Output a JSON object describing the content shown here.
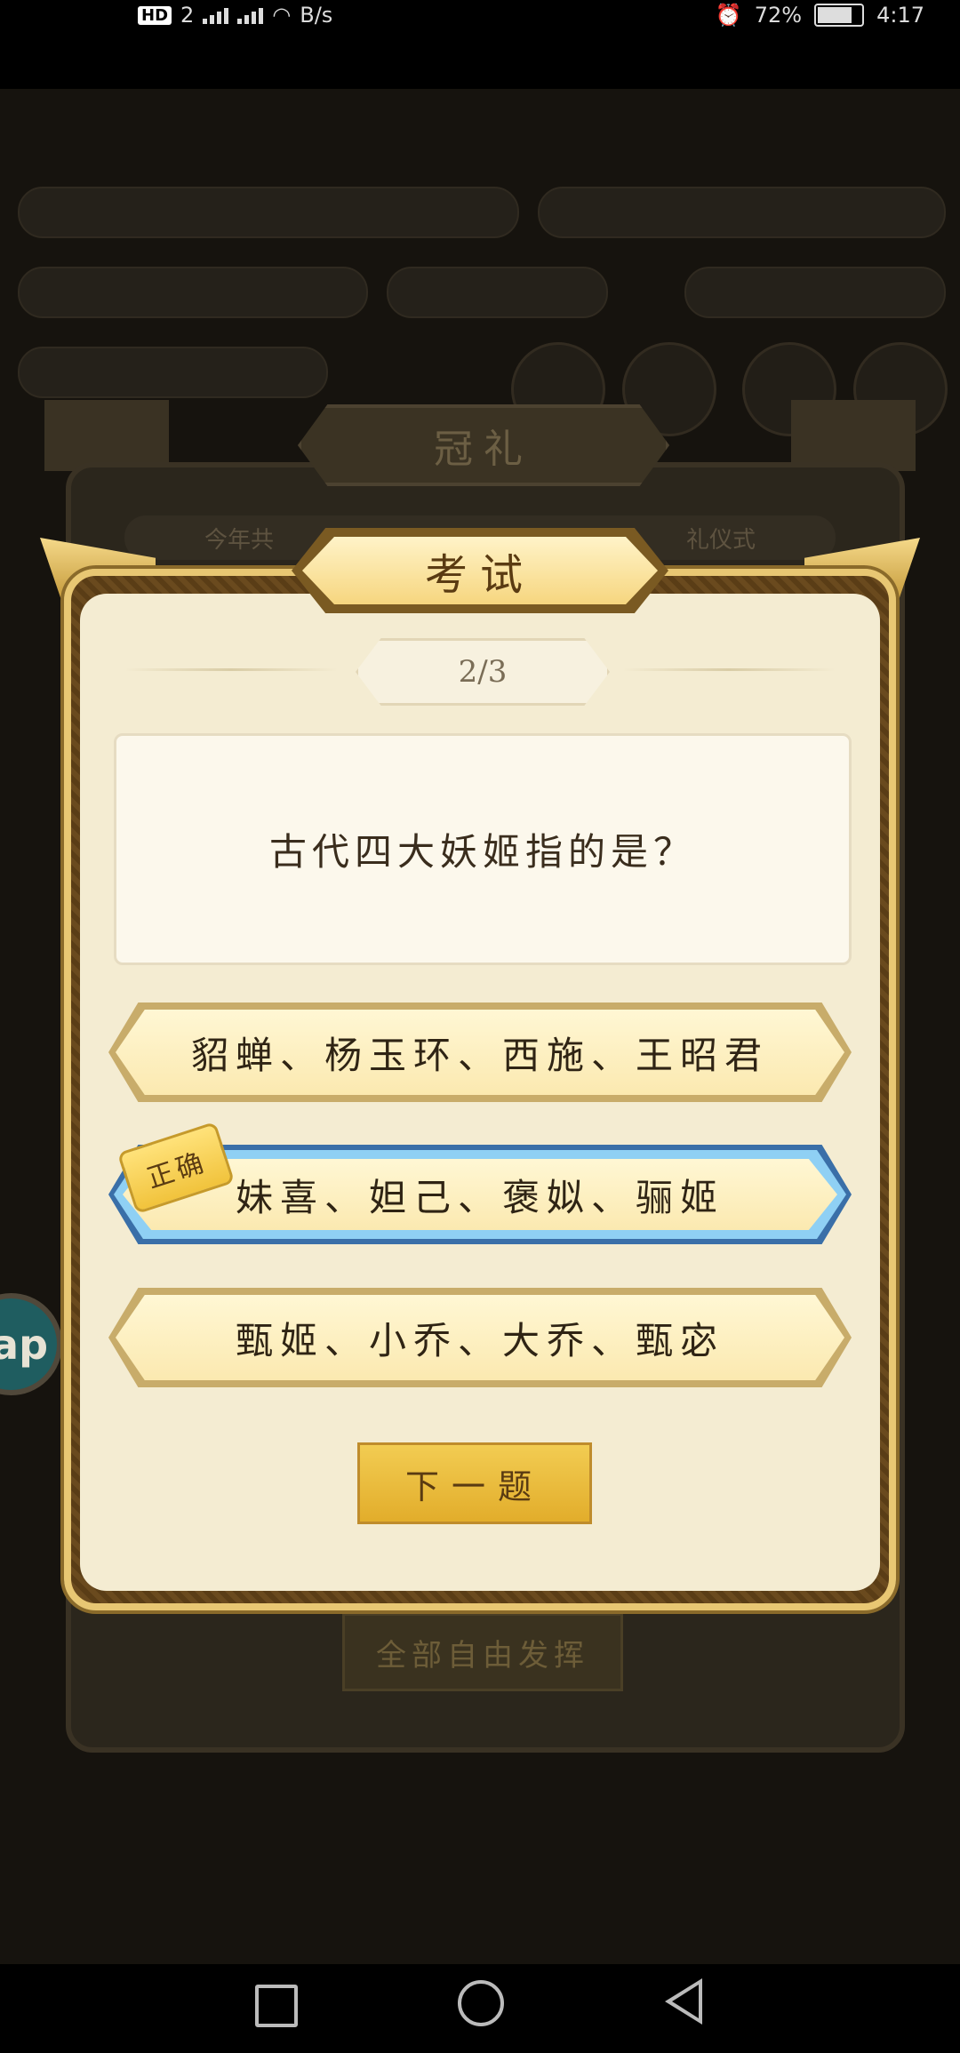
{
  "status_bar": {
    "hd_label": "HD",
    "sim_label": "2",
    "net_speed": "B/s",
    "battery": "72%",
    "time": "4:17"
  },
  "background": {
    "ceremony_title": "冠礼",
    "ceremony_subtitle_left": "今年共",
    "ceremony_subtitle_right": "礼仪式",
    "free_play_button": "全部自由发挥",
    "side_bubble": "ap"
  },
  "exam": {
    "title": "考试",
    "progress": "2/3",
    "question": "古代四大妖姬指的是？",
    "options": [
      {
        "label": "貂蝉、杨玉环、西施、王昭君",
        "correct": false
      },
      {
        "label": "妹喜、妲己、褒姒、骊姬",
        "correct": true
      },
      {
        "label": "甄姬、小乔、大乔、甄宓",
        "correct": false
      }
    ],
    "correct_badge": "正确",
    "next_button": "下一题"
  },
  "colors": {
    "correct_outline": "#8fd0f4",
    "option_fill": "#fff7d4",
    "button_gold": "#f2cc52"
  }
}
